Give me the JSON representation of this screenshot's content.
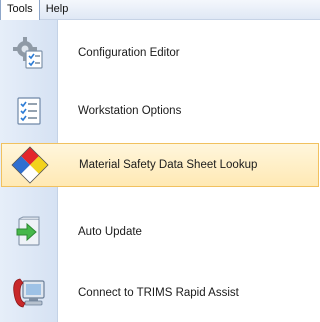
{
  "menubar": {
    "items": [
      {
        "label": "Tools",
        "active": true
      },
      {
        "label": "Help",
        "active": false
      }
    ]
  },
  "menu": {
    "items": [
      {
        "label": "Configuration Editor",
        "icon": "gear-checklist-icon",
        "highlighted": false
      },
      {
        "label": "Workstation Options",
        "icon": "checklist-icon",
        "highlighted": false
      },
      {
        "label": "Material Safety Data Sheet Lookup",
        "icon": "hazard-diamond-icon",
        "highlighted": true
      },
      {
        "label": "Auto Update",
        "icon": "update-arrow-icon",
        "highlighted": false
      },
      {
        "label": "Connect to TRIMS Rapid Assist",
        "icon": "telephone-computer-icon",
        "highlighted": false
      }
    ]
  },
  "colors": {
    "highlight_fill": "#ffe9b4",
    "highlight_border": "#f1c15f",
    "gutter": "#dce6f4"
  }
}
